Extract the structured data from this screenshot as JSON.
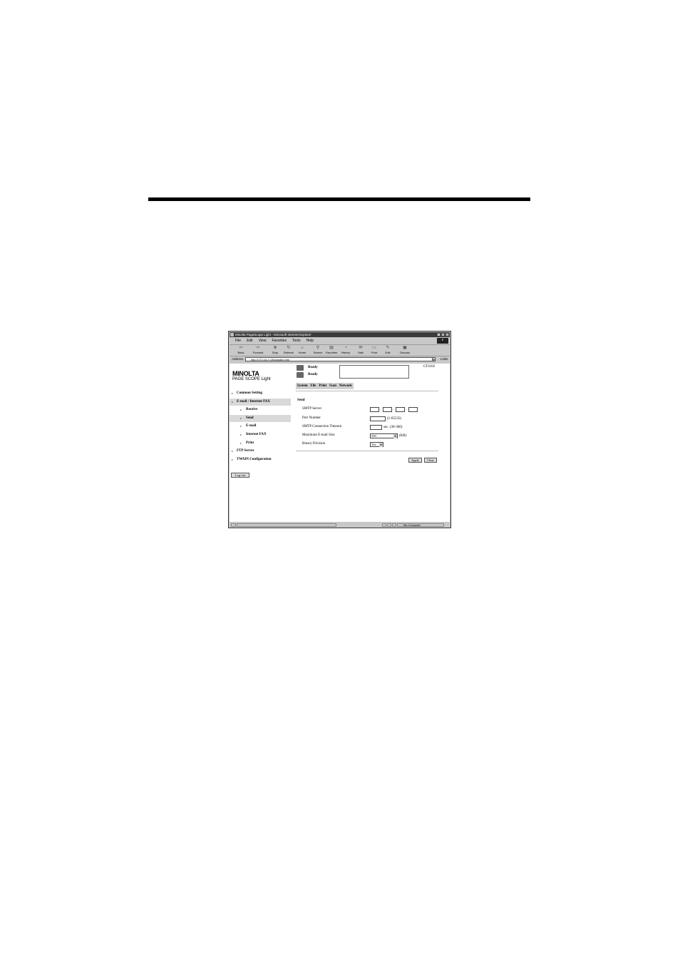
{
  "window": {
    "title": "Minolta PageScope Light - Microsoft Internet Explorer",
    "controls": [
      "_",
      "□",
      "×"
    ]
  },
  "menu": [
    "File",
    "Edit",
    "View",
    "Favorites",
    "Tools",
    "Help"
  ],
  "toolbar": [
    {
      "label": "Back",
      "icon": "back-arrow-icon"
    },
    {
      "label": "Forward",
      "icon": "forward-arrow-icon"
    },
    {
      "label": "Stop",
      "icon": "stop-icon"
    },
    {
      "label": "Refresh",
      "icon": "refresh-icon"
    },
    {
      "label": "Home",
      "icon": "home-icon"
    },
    {
      "label": "Search",
      "icon": "search-icon"
    },
    {
      "label": "Favorites",
      "icon": "favorites-icon"
    },
    {
      "label": "History",
      "icon": "history-icon"
    },
    {
      "label": "Mail",
      "icon": "mail-icon"
    },
    {
      "label": "Print",
      "icon": "print-icon"
    },
    {
      "label": "Edit",
      "icon": "edit-icon"
    },
    {
      "label": "Discuss",
      "icon": "discuss-icon"
    }
  ],
  "address": {
    "label": "Address",
    "url": "http://172.16.2.100/aindex.htm",
    "links_label": "Links"
  },
  "logo": {
    "brand": "MINOLTA",
    "product": "PAGE SCOPE Light"
  },
  "sidebar": {
    "items": [
      {
        "label": "Common Setting",
        "level": 0,
        "selected": false
      },
      {
        "label": "E-mail / Internet FAX",
        "level": 0,
        "selected": true
      },
      {
        "label": "Receive",
        "level": 1,
        "selected": false
      },
      {
        "label": "Send",
        "level": 1,
        "selected": true
      },
      {
        "label": "E-mail",
        "level": 1,
        "selected": false
      },
      {
        "label": "Internet FAX",
        "level": 1,
        "selected": false
      },
      {
        "label": "Print",
        "level": 1,
        "selected": false
      },
      {
        "label": "FTP Server",
        "level": 0,
        "selected": false
      },
      {
        "label": "TWAIN Configuration",
        "level": 0,
        "selected": false
      }
    ],
    "logout_label": "Log-out"
  },
  "status": {
    "printer": "Ready",
    "scanner": "Ready",
    "model": "CF3102"
  },
  "tabs": [
    "System",
    "File",
    "Print",
    "Scan",
    "Network"
  ],
  "form": {
    "section": "Send",
    "smtp_server_label": "SMTP Server",
    "port_label": "Port Number",
    "port_hint": "(1-65535)",
    "timeout_label": "SMTP Connection Timeout",
    "timeout_hint": "sec. (30-300)",
    "max_size_label": "Maximum E-mail Size",
    "max_size_value": "500",
    "max_size_unit": "(KB)",
    "binary_label": "Binary Division",
    "binary_value": "Yes",
    "apply_label": "Apply",
    "clear_label": "Clear"
  },
  "statusbar": {
    "zone": "My Computer"
  }
}
